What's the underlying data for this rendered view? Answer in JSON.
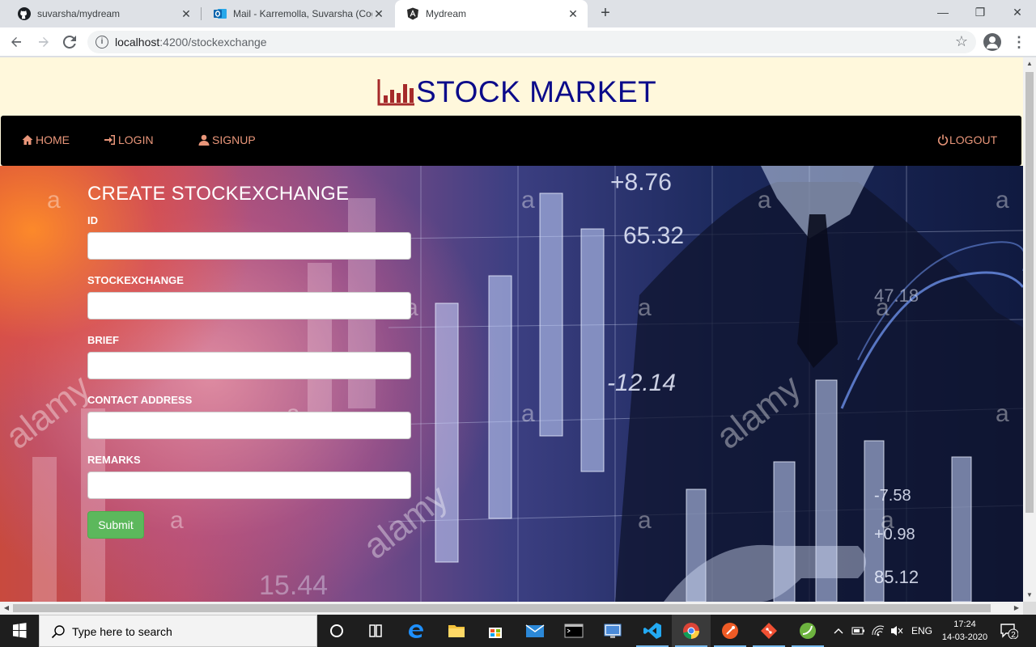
{
  "browser": {
    "tabs": [
      {
        "title": "suvarsha/mydream",
        "icon": "github-icon",
        "active": false
      },
      {
        "title": "Mail - Karremolla, Suvarsha (Cog",
        "icon": "outlook-icon",
        "active": false
      },
      {
        "title": "Mydream",
        "icon": "angular-icon",
        "active": true
      }
    ],
    "new_tab": "+",
    "url_host": "localhost",
    "url_path": ":4200/stockexchange",
    "window_controls": {
      "minimize": "—",
      "restore": "❐",
      "close": "✕"
    }
  },
  "site": {
    "brand": "STOCK MARKET",
    "nav": {
      "home": "HOME",
      "login": "LOGIN",
      "signup": "SIGNUP",
      "logout": "LOGOUT"
    },
    "colors": {
      "nav_link": "#e9967a",
      "brand": "#0b0b8a",
      "header_bg": "#fff8dc",
      "submit_bg": "#5cb85c"
    }
  },
  "form": {
    "title": "CREATE STOCKEXCHANGE",
    "fields": [
      {
        "label": "ID",
        "value": ""
      },
      {
        "label": "STOCKEXCHANGE",
        "value": ""
      },
      {
        "label": "BRIEF",
        "value": ""
      },
      {
        "label": "CONTACT ADDRESS",
        "value": ""
      },
      {
        "label": "REMARKS",
        "value": ""
      }
    ],
    "submit": "Submit"
  },
  "hero_overlay": {
    "numbers": [
      "+8.76",
      "65.32",
      "-12.14",
      "47.18",
      "-7.58",
      "+0.98",
      "85.12",
      "15.44"
    ],
    "watermarks": [
      "alamy",
      "a"
    ]
  },
  "taskbar": {
    "search_placeholder": "Type here to search",
    "language": "ENG",
    "time": "17:24",
    "date": "14-03-2020",
    "notification_count": "2"
  }
}
